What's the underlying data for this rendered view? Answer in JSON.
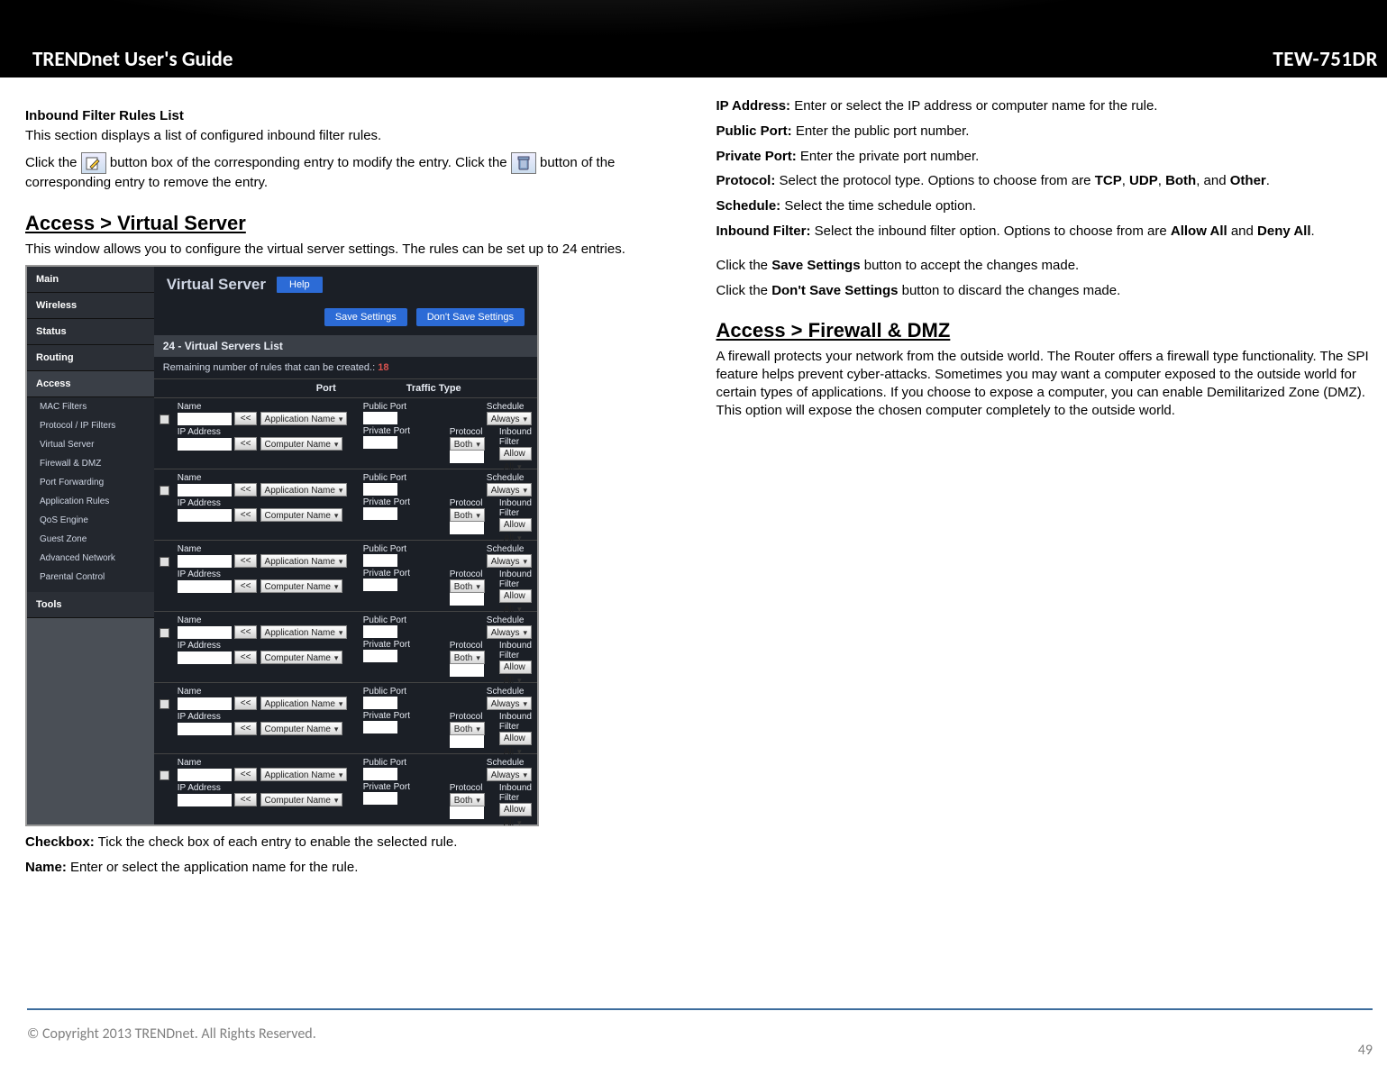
{
  "header": {
    "left": "TRENDnet User's Guide",
    "right": "TEW-751DR"
  },
  "left": {
    "h1": "Inbound Filter Rules List",
    "p1": "This section displays a list of configured inbound filter rules.",
    "p2a": "Click the ",
    "p2b": " button box of the corresponding entry to modify the entry. Click the ",
    "p2c": " button of the corresponding entry to remove the entry.",
    "h2": "Access > Virtual Server",
    "p3": "This window allows you to configure the virtual server settings. The rules can be set up to 24 entries.",
    "cb_label": "Checkbox:",
    "cb_text": " Tick the check box of each entry to enable the selected rule.",
    "name_label": "Name:",
    "name_text": " Enter or select the application name for the rule."
  },
  "right": {
    "ip_l": "IP Address:",
    "ip_t": " Enter or select the IP address or computer name for the rule.",
    "pub_l": "Public Port:",
    "pub_t": " Enter the public port number.",
    "priv_l": "Private Port:",
    "priv_t": " Enter the private port number.",
    "proto_l": "Protocol:",
    "proto_t1": " Select the protocol type. Options to choose from are ",
    "proto_tcp": "TCP",
    "proto_s1": ", ",
    "proto_udp": "UDP",
    "proto_s2": ", ",
    "proto_both": "Both",
    "proto_s3": ", and ",
    "proto_other": "Other",
    "proto_end": ".",
    "sched_l": "Schedule:",
    "sched_t": " Select the time schedule option.",
    "inf_l": "Inbound Filter:",
    "inf_t1": " Select the inbound filter option. Options to choose from are ",
    "inf_allow": "Allow All",
    "inf_and": " and ",
    "inf_deny": "Deny All",
    "inf_end": ".",
    "save1a": "Click the ",
    "save1b": "Save Settings",
    "save1c": " button to accept the changes made.",
    "save2a": "Click the ",
    "save2b": "Don't Save Settings",
    "save2c": " button to discard the changes made.",
    "h3": "Access > Firewall & DMZ",
    "p_fw": "A firewall protects your network from the outside world. The Router offers a firewall type functionality. The SPI feature helps prevent cyber-attacks. Sometimes you may want a computer exposed to the outside world for certain types of applications. If you choose to expose a computer, you can enable Demilitarized Zone (DMZ). This option will expose the chosen computer completely to the outside world."
  },
  "fig": {
    "nav_main": [
      "Main",
      "Wireless",
      "Status",
      "Routing",
      "Access"
    ],
    "nav_sub": [
      "MAC Filters",
      "Protocol / IP Filters",
      "Virtual Server",
      "Firewall & DMZ",
      "Port Forwarding",
      "Application Rules",
      "QoS Engine",
      "Guest Zone",
      "Advanced Network",
      "Parental Control"
    ],
    "nav_main2": "Tools",
    "title": "Virtual Server",
    "help": "Help",
    "save": "Save Settings",
    "dont_save": "Don't Save Settings",
    "panel_head": "24 - Virtual Servers List",
    "remaining_text": "Remaining number of rules that can be created.:",
    "remaining_count": "18",
    "col_port": "Port",
    "col_traffic": "Traffic Type",
    "row": {
      "name": "Name",
      "ip": "IP Address",
      "assign": "<<",
      "app_sel": "Application Name",
      "comp_sel": "Computer Name",
      "pub": "Public Port",
      "priv": "Private Port",
      "proto": "Protocol",
      "proto_sel": "Both",
      "sched": "Schedule",
      "sched_sel": "Always",
      "inf": "Inbound Filter",
      "inf_sel": "Allow All"
    },
    "row_count": 6
  },
  "footer": {
    "copy": "© Copyright 2013 TRENDnet. All Rights Reserved.",
    "page": "49"
  }
}
